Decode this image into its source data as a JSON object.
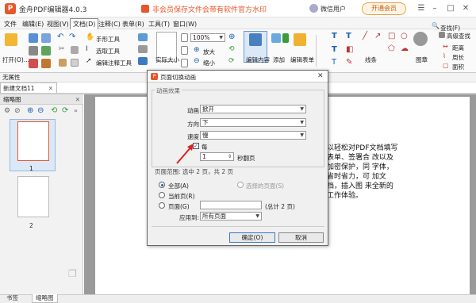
{
  "titlebar": {
    "app_title": "金舟PDF编辑器4.0.3",
    "warning": "非会员保存文件会带有软件官方水印",
    "user": "微信用户",
    "vip": "开通会员",
    "logo_letter": "P"
  },
  "menu": [
    "文件",
    "编辑(E)",
    "视图(V)",
    "文档(D)",
    "注释(C)",
    "表单(R)",
    "工具(T)",
    "窗口(W)"
  ],
  "ribbon": {
    "open": "打开(O)...",
    "hand_tool": "手形工具",
    "select_text": "选取工具",
    "edit_annot": "编辑注释工具",
    "actual_size": "实际大小",
    "zoom_value": "100%",
    "zoom_in": "放大",
    "zoom_out": "缩小",
    "edit_content": "编辑内容",
    "add": "添加",
    "edit_form": "编辑表单",
    "lines": "线条",
    "stamp": "图章",
    "find": "查找(F)",
    "adv_find": "高级查找",
    "distance": "距离",
    "perimeter": "周长",
    "area": "面积"
  },
  "propbar": "无属性",
  "doctab": "新建文档11",
  "thumbnails": {
    "title": "缩略图",
    "pages": [
      "1",
      "2"
    ]
  },
  "document_text": "以轻松对PDF文档填写表单、签署合 改以及加密保护，同 字体，省时省力，可 加文档，插入图 来全新的工作体验。",
  "bottom_tabs": [
    "书签",
    "缩略图"
  ],
  "dialog": {
    "title": "页面切换动画",
    "group_effect": "动画效果",
    "anim_label": "动画",
    "anim_value": "掀开",
    "dir_label": "方向",
    "dir_value": "下",
    "speed_label": "速度",
    "speed_value": "慢",
    "auto_label": "每",
    "auto_value": "1",
    "auto_suffix": "秒翻页",
    "page_range": "页面范围: 选中 2 页，共 2 页",
    "all": "全部(A)",
    "selected": "选择的页面(S)",
    "current": "当前页(R)",
    "pages": "页面(G)",
    "pages_total": "(总计 2 页)",
    "apply_label": "应用到:",
    "apply_value": "所有页面",
    "ok": "确定(O)",
    "cancel": "取消"
  },
  "colors": {
    "accent": "#e8562a",
    "link": "#1a5fb4"
  }
}
